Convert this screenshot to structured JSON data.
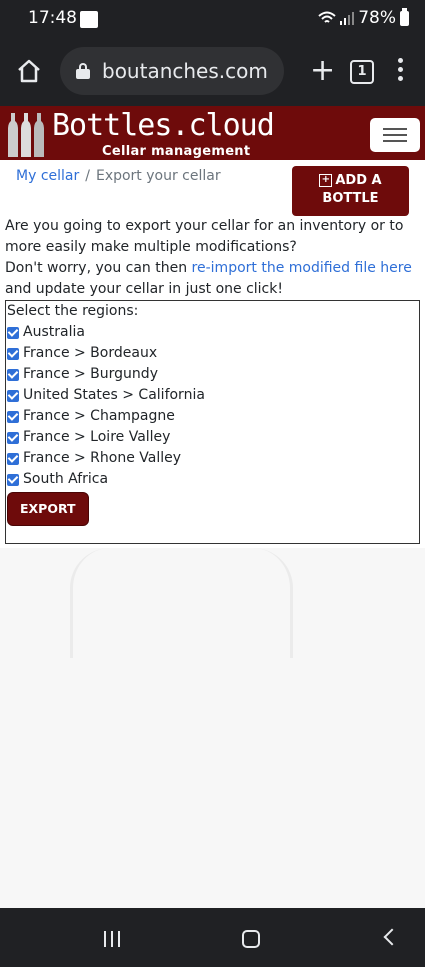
{
  "status_bar": {
    "time": "17:48",
    "battery": "78%"
  },
  "browser": {
    "url": "boutanches.com",
    "tab_count": "1"
  },
  "site": {
    "logo_text": "Bottles.cloud",
    "logo_subtitle": "Cellar management"
  },
  "breadcrumb": {
    "home": "My cellar",
    "separator": "/",
    "current": "Export your cellar"
  },
  "add_button": {
    "label_line1": "ADD A",
    "label_line2": "BOTTLE"
  },
  "intro": {
    "line1": "Are you going to export your cellar for an inventory or to more easily make multiple modifications?",
    "line2_prefix": "Don't worry, you can then ",
    "line2_link": "re-import the modified file here",
    "line2_suffix": " and update your cellar in just one click!"
  },
  "regions": {
    "heading": "Select the regions:",
    "items": [
      {
        "label": "Australia",
        "checked": true
      },
      {
        "label": "France > Bordeaux",
        "checked": true
      },
      {
        "label": "France > Burgundy",
        "checked": true
      },
      {
        "label": "United States > California",
        "checked": true
      },
      {
        "label": "France > Champagne",
        "checked": true
      },
      {
        "label": "France > Loire Valley",
        "checked": true
      },
      {
        "label": "France > Rhone Valley",
        "checked": true
      },
      {
        "label": "South Africa",
        "checked": true
      }
    ],
    "export_label": "EXPORT"
  },
  "colors": {
    "brand": "#6e0b0b",
    "link": "#2f6fd7",
    "checkbox": "#2f6fd7"
  }
}
